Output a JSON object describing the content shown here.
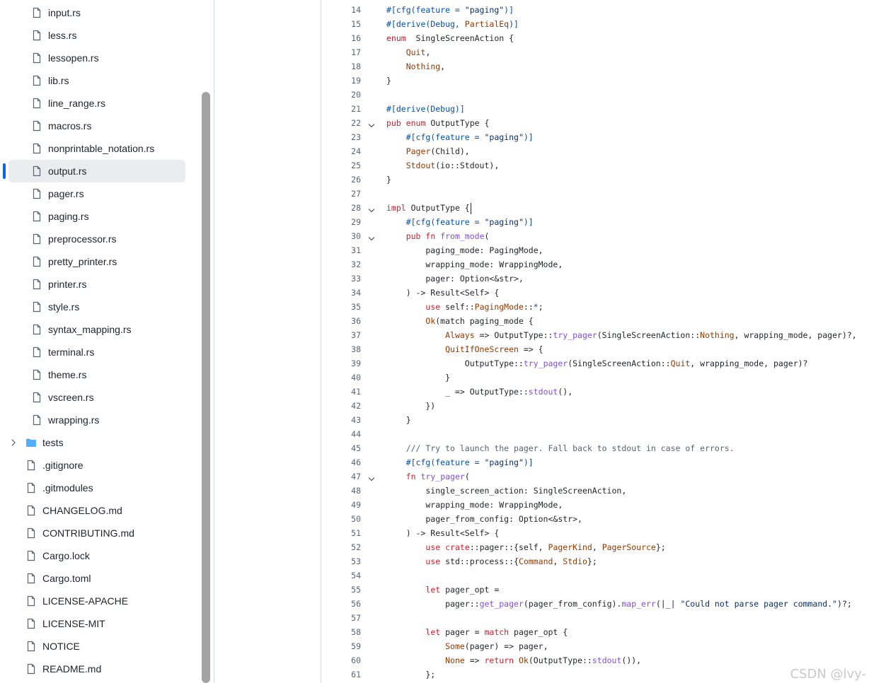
{
  "tree": [
    {
      "name": "input.rs",
      "type": "file",
      "level": 2
    },
    {
      "name": "less.rs",
      "type": "file",
      "level": 2
    },
    {
      "name": "lessopen.rs",
      "type": "file",
      "level": 2
    },
    {
      "name": "lib.rs",
      "type": "file",
      "level": 2
    },
    {
      "name": "line_range.rs",
      "type": "file",
      "level": 2
    },
    {
      "name": "macros.rs",
      "type": "file",
      "level": 2
    },
    {
      "name": "nonprintable_notation.rs",
      "type": "file",
      "level": 2
    },
    {
      "name": "output.rs",
      "type": "file",
      "level": 2,
      "selected": true
    },
    {
      "name": "pager.rs",
      "type": "file",
      "level": 2
    },
    {
      "name": "paging.rs",
      "type": "file",
      "level": 2
    },
    {
      "name": "preprocessor.rs",
      "type": "file",
      "level": 2
    },
    {
      "name": "pretty_printer.rs",
      "type": "file",
      "level": 2
    },
    {
      "name": "printer.rs",
      "type": "file",
      "level": 2
    },
    {
      "name": "style.rs",
      "type": "file",
      "level": 2
    },
    {
      "name": "syntax_mapping.rs",
      "type": "file",
      "level": 2
    },
    {
      "name": "terminal.rs",
      "type": "file",
      "level": 2
    },
    {
      "name": "theme.rs",
      "type": "file",
      "level": 2
    },
    {
      "name": "vscreen.rs",
      "type": "file",
      "level": 2
    },
    {
      "name": "wrapping.rs",
      "type": "file",
      "level": 2
    },
    {
      "name": "tests",
      "type": "folder",
      "level": 1
    },
    {
      "name": ".gitignore",
      "type": "file",
      "level": 1
    },
    {
      "name": ".gitmodules",
      "type": "file",
      "level": 1
    },
    {
      "name": "CHANGELOG.md",
      "type": "file",
      "level": 1
    },
    {
      "name": "CONTRIBUTING.md",
      "type": "file",
      "level": 1
    },
    {
      "name": "Cargo.lock",
      "type": "file",
      "level": 1
    },
    {
      "name": "Cargo.toml",
      "type": "file",
      "level": 1
    },
    {
      "name": "LICENSE-APACHE",
      "type": "file",
      "level": 1
    },
    {
      "name": "LICENSE-MIT",
      "type": "file",
      "level": 1
    },
    {
      "name": "NOTICE",
      "type": "file",
      "level": 1
    },
    {
      "name": "README.md",
      "type": "file",
      "level": 1
    }
  ],
  "code": [
    {
      "n": "14",
      "t": [
        [
          "a",
          "#[cfg(feature = "
        ],
        [
          "s",
          "\"paging\""
        ],
        [
          "a",
          ")]"
        ]
      ]
    },
    {
      "n": "15",
      "t": [
        [
          "a",
          "#[derive(Debug, "
        ],
        [
          "o",
          "PartialEq"
        ],
        [
          "a",
          ")]"
        ]
      ]
    },
    {
      "n": "16",
      "t": [
        [
          "k",
          "enum"
        ],
        [
          "",
          "  SingleScreenAction {"
        ]
      ]
    },
    {
      "n": "17",
      "t": [
        [
          "",
          "    "
        ],
        [
          "o",
          "Quit"
        ],
        [
          "",
          ","
        ]
      ]
    },
    {
      "n": "18",
      "t": [
        [
          "",
          "    "
        ],
        [
          "o",
          "Nothing"
        ],
        [
          "",
          ","
        ]
      ]
    },
    {
      "n": "19",
      "t": [
        [
          "",
          "}"
        ]
      ]
    },
    {
      "n": "20",
      "t": []
    },
    {
      "n": "21",
      "t": [
        [
          "a",
          "#[derive(Debug)]"
        ]
      ]
    },
    {
      "n": "22",
      "fold": true,
      "t": [
        [
          "k",
          "pub enum"
        ],
        [
          "",
          " OutputType {"
        ]
      ]
    },
    {
      "n": "23",
      "t": [
        [
          "",
          "    "
        ],
        [
          "a",
          "#[cfg(feature = "
        ],
        [
          "s",
          "\"paging\""
        ],
        [
          "a",
          ")]"
        ]
      ]
    },
    {
      "n": "24",
      "t": [
        [
          "",
          "    "
        ],
        [
          "o",
          "Pager"
        ],
        [
          "",
          "(Child),"
        ]
      ]
    },
    {
      "n": "25",
      "t": [
        [
          "",
          "    "
        ],
        [
          "o",
          "Stdout"
        ],
        [
          "",
          "(io::Stdout),"
        ]
      ]
    },
    {
      "n": "26",
      "t": [
        [
          "",
          "}"
        ]
      ]
    },
    {
      "n": "27",
      "t": []
    },
    {
      "n": "28",
      "fold": true,
      "cursor": true,
      "t": [
        [
          "k",
          "impl"
        ],
        [
          "",
          " OutputType {"
        ]
      ]
    },
    {
      "n": "29",
      "t": [
        [
          "",
          "    "
        ],
        [
          "a",
          "#[cfg(feature = "
        ],
        [
          "s",
          "\"paging\""
        ],
        [
          "a",
          ")]"
        ]
      ]
    },
    {
      "n": "30",
      "fold": true,
      "t": [
        [
          "",
          "    "
        ],
        [
          "k",
          "pub fn"
        ],
        [
          "",
          " "
        ],
        [
          "f",
          "from_mode"
        ],
        [
          "",
          "("
        ]
      ]
    },
    {
      "n": "31",
      "t": [
        [
          "",
          "        paging_mode: PagingMode,"
        ]
      ]
    },
    {
      "n": "32",
      "t": [
        [
          "",
          "        wrapping_mode: WrappingMode,"
        ]
      ]
    },
    {
      "n": "33",
      "t": [
        [
          "",
          "        pager: Option<&str>,"
        ]
      ]
    },
    {
      "n": "34",
      "t": [
        [
          "",
          "    ) -> Result<Self> {"
        ]
      ]
    },
    {
      "n": "35",
      "t": [
        [
          "",
          "        "
        ],
        [
          "k",
          "use"
        ],
        [
          "",
          " self::"
        ],
        [
          "o",
          "PagingMode"
        ],
        [
          "",
          "::"
        ],
        [
          "a",
          "*"
        ],
        [
          "",
          ";"
        ]
      ]
    },
    {
      "n": "36",
      "t": [
        [
          "",
          "        "
        ],
        [
          "o",
          "Ok"
        ],
        [
          "",
          "(match paging_mode {"
        ]
      ]
    },
    {
      "n": "37",
      "t": [
        [
          "",
          "            "
        ],
        [
          "o",
          "Always"
        ],
        [
          "",
          " => OutputType::"
        ],
        [
          "f",
          "try_pager"
        ],
        [
          "",
          "(SingleScreenAction::"
        ],
        [
          "o",
          "Nothing"
        ],
        [
          "",
          ", wrapping_mode, pager)?,"
        ]
      ]
    },
    {
      "n": "38",
      "t": [
        [
          "",
          "            "
        ],
        [
          "o",
          "QuitIfOneScreen"
        ],
        [
          "",
          " => {"
        ]
      ]
    },
    {
      "n": "39",
      "t": [
        [
          "",
          "                OutputType::"
        ],
        [
          "f",
          "try_pager"
        ],
        [
          "",
          "(SingleScreenAction::"
        ],
        [
          "o",
          "Quit"
        ],
        [
          "",
          ", wrapping_mode, pager)?"
        ]
      ]
    },
    {
      "n": "40",
      "t": [
        [
          "",
          "            }"
        ]
      ]
    },
    {
      "n": "41",
      "t": [
        [
          "",
          "            _ => OutputType::"
        ],
        [
          "f",
          "stdout"
        ],
        [
          "",
          "(),"
        ]
      ]
    },
    {
      "n": "42",
      "t": [
        [
          "",
          "        })"
        ]
      ]
    },
    {
      "n": "43",
      "t": [
        [
          "",
          "    }"
        ]
      ]
    },
    {
      "n": "44",
      "t": []
    },
    {
      "n": "45",
      "t": [
        [
          "",
          "    "
        ],
        [
          "c",
          "/// Try to launch the pager. Fall back to stdout in case of errors."
        ]
      ]
    },
    {
      "n": "46",
      "t": [
        [
          "",
          "    "
        ],
        [
          "a",
          "#[cfg(feature = "
        ],
        [
          "s",
          "\"paging\""
        ],
        [
          "a",
          ")]"
        ]
      ]
    },
    {
      "n": "47",
      "fold": true,
      "t": [
        [
          "",
          "    "
        ],
        [
          "k",
          "fn"
        ],
        [
          "",
          " "
        ],
        [
          "f",
          "try_pager"
        ],
        [
          "",
          "("
        ]
      ]
    },
    {
      "n": "48",
      "t": [
        [
          "",
          "        single_screen_action: SingleScreenAction,"
        ]
      ]
    },
    {
      "n": "49",
      "t": [
        [
          "",
          "        wrapping_mode: WrappingMode,"
        ]
      ]
    },
    {
      "n": "50",
      "t": [
        [
          "",
          "        pager_from_config: Option<&str>,"
        ]
      ]
    },
    {
      "n": "51",
      "t": [
        [
          "",
          "    ) -> Result<Self> {"
        ]
      ]
    },
    {
      "n": "52",
      "t": [
        [
          "",
          "        "
        ],
        [
          "k",
          "use"
        ],
        [
          "",
          " "
        ],
        [
          "k",
          "crate"
        ],
        [
          "",
          "::pager::{self, "
        ],
        [
          "o",
          "PagerKind"
        ],
        [
          "",
          ", "
        ],
        [
          "o",
          "PagerSource"
        ],
        [
          "",
          "};"
        ]
      ]
    },
    {
      "n": "53",
      "t": [
        [
          "",
          "        "
        ],
        [
          "k",
          "use"
        ],
        [
          "",
          " std::process::{"
        ],
        [
          "o",
          "Command"
        ],
        [
          "",
          ", "
        ],
        [
          "o",
          "Stdio"
        ],
        [
          "",
          "};"
        ]
      ]
    },
    {
      "n": "54",
      "t": []
    },
    {
      "n": "55",
      "t": [
        [
          "",
          "        "
        ],
        [
          "k",
          "let"
        ],
        [
          "",
          " pager_opt ="
        ]
      ]
    },
    {
      "n": "56",
      "t": [
        [
          "",
          "            pager::"
        ],
        [
          "f",
          "get_pager"
        ],
        [
          "",
          "(pager_from_config)."
        ],
        [
          "f",
          "map_err"
        ],
        [
          "",
          "(|_| "
        ],
        [
          "s",
          "\"Could not parse pager command.\""
        ],
        [
          "",
          ")?;"
        ]
      ]
    },
    {
      "n": "57",
      "t": []
    },
    {
      "n": "58",
      "t": [
        [
          "",
          "        "
        ],
        [
          "k",
          "let"
        ],
        [
          "",
          " pager = "
        ],
        [
          "k",
          "match"
        ],
        [
          "",
          " pager_opt {"
        ]
      ]
    },
    {
      "n": "59",
      "t": [
        [
          "",
          "            "
        ],
        [
          "o",
          "Some"
        ],
        [
          "",
          "(pager) => pager,"
        ]
      ]
    },
    {
      "n": "60",
      "t": [
        [
          "",
          "            "
        ],
        [
          "o",
          "None"
        ],
        [
          "",
          " => "
        ],
        [
          "k",
          "return"
        ],
        [
          "",
          " "
        ],
        [
          "o",
          "Ok"
        ],
        [
          "",
          "(OutputType::"
        ],
        [
          "f",
          "stdout"
        ],
        [
          "",
          "()),"
        ]
      ]
    },
    {
      "n": "61",
      "t": [
        [
          "",
          "        };"
        ]
      ]
    }
  ],
  "watermark": "CSDN @lvy-",
  "colors": {
    "accent": "#0969da",
    "keyword": "#cf222e",
    "function": "#8250df",
    "string": "#0a3069"
  }
}
